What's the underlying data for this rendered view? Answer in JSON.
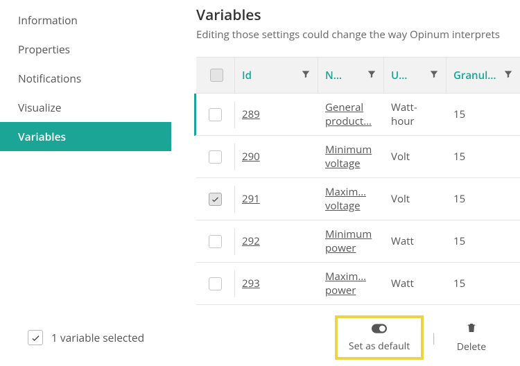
{
  "sidebar": {
    "items": [
      {
        "label": "Information",
        "active": false
      },
      {
        "label": "Properties",
        "active": false
      },
      {
        "label": "Notifications",
        "active": false
      },
      {
        "label": "Visualize",
        "active": false
      },
      {
        "label": "Variables",
        "active": true
      }
    ]
  },
  "main": {
    "title": "Variables",
    "subtitle": "Editing those settings could change the way Opinum interprets"
  },
  "table": {
    "columns": {
      "id": "Id",
      "name": "N…",
      "unit": "U…",
      "granularity": "Granul…"
    },
    "rows": [
      {
        "checked": false,
        "id": "289",
        "name": "General product…",
        "unit": "Watt-hour",
        "granularity": "15"
      },
      {
        "checked": false,
        "id": "290",
        "name": "Minimum voltage",
        "unit": "Volt",
        "granularity": "15"
      },
      {
        "checked": true,
        "id": "291",
        "name": "Maxim… voltage",
        "unit": "Volt",
        "granularity": "15"
      },
      {
        "checked": false,
        "id": "292",
        "name": "Minimum power",
        "unit": "Watt",
        "granularity": "15"
      },
      {
        "checked": false,
        "id": "293",
        "name": "Maxim… power",
        "unit": "Watt",
        "granularity": "15"
      }
    ]
  },
  "footer": {
    "selection_text": "1 variable selected",
    "set_default_label": "Set as default",
    "delete_label": "Delete"
  }
}
